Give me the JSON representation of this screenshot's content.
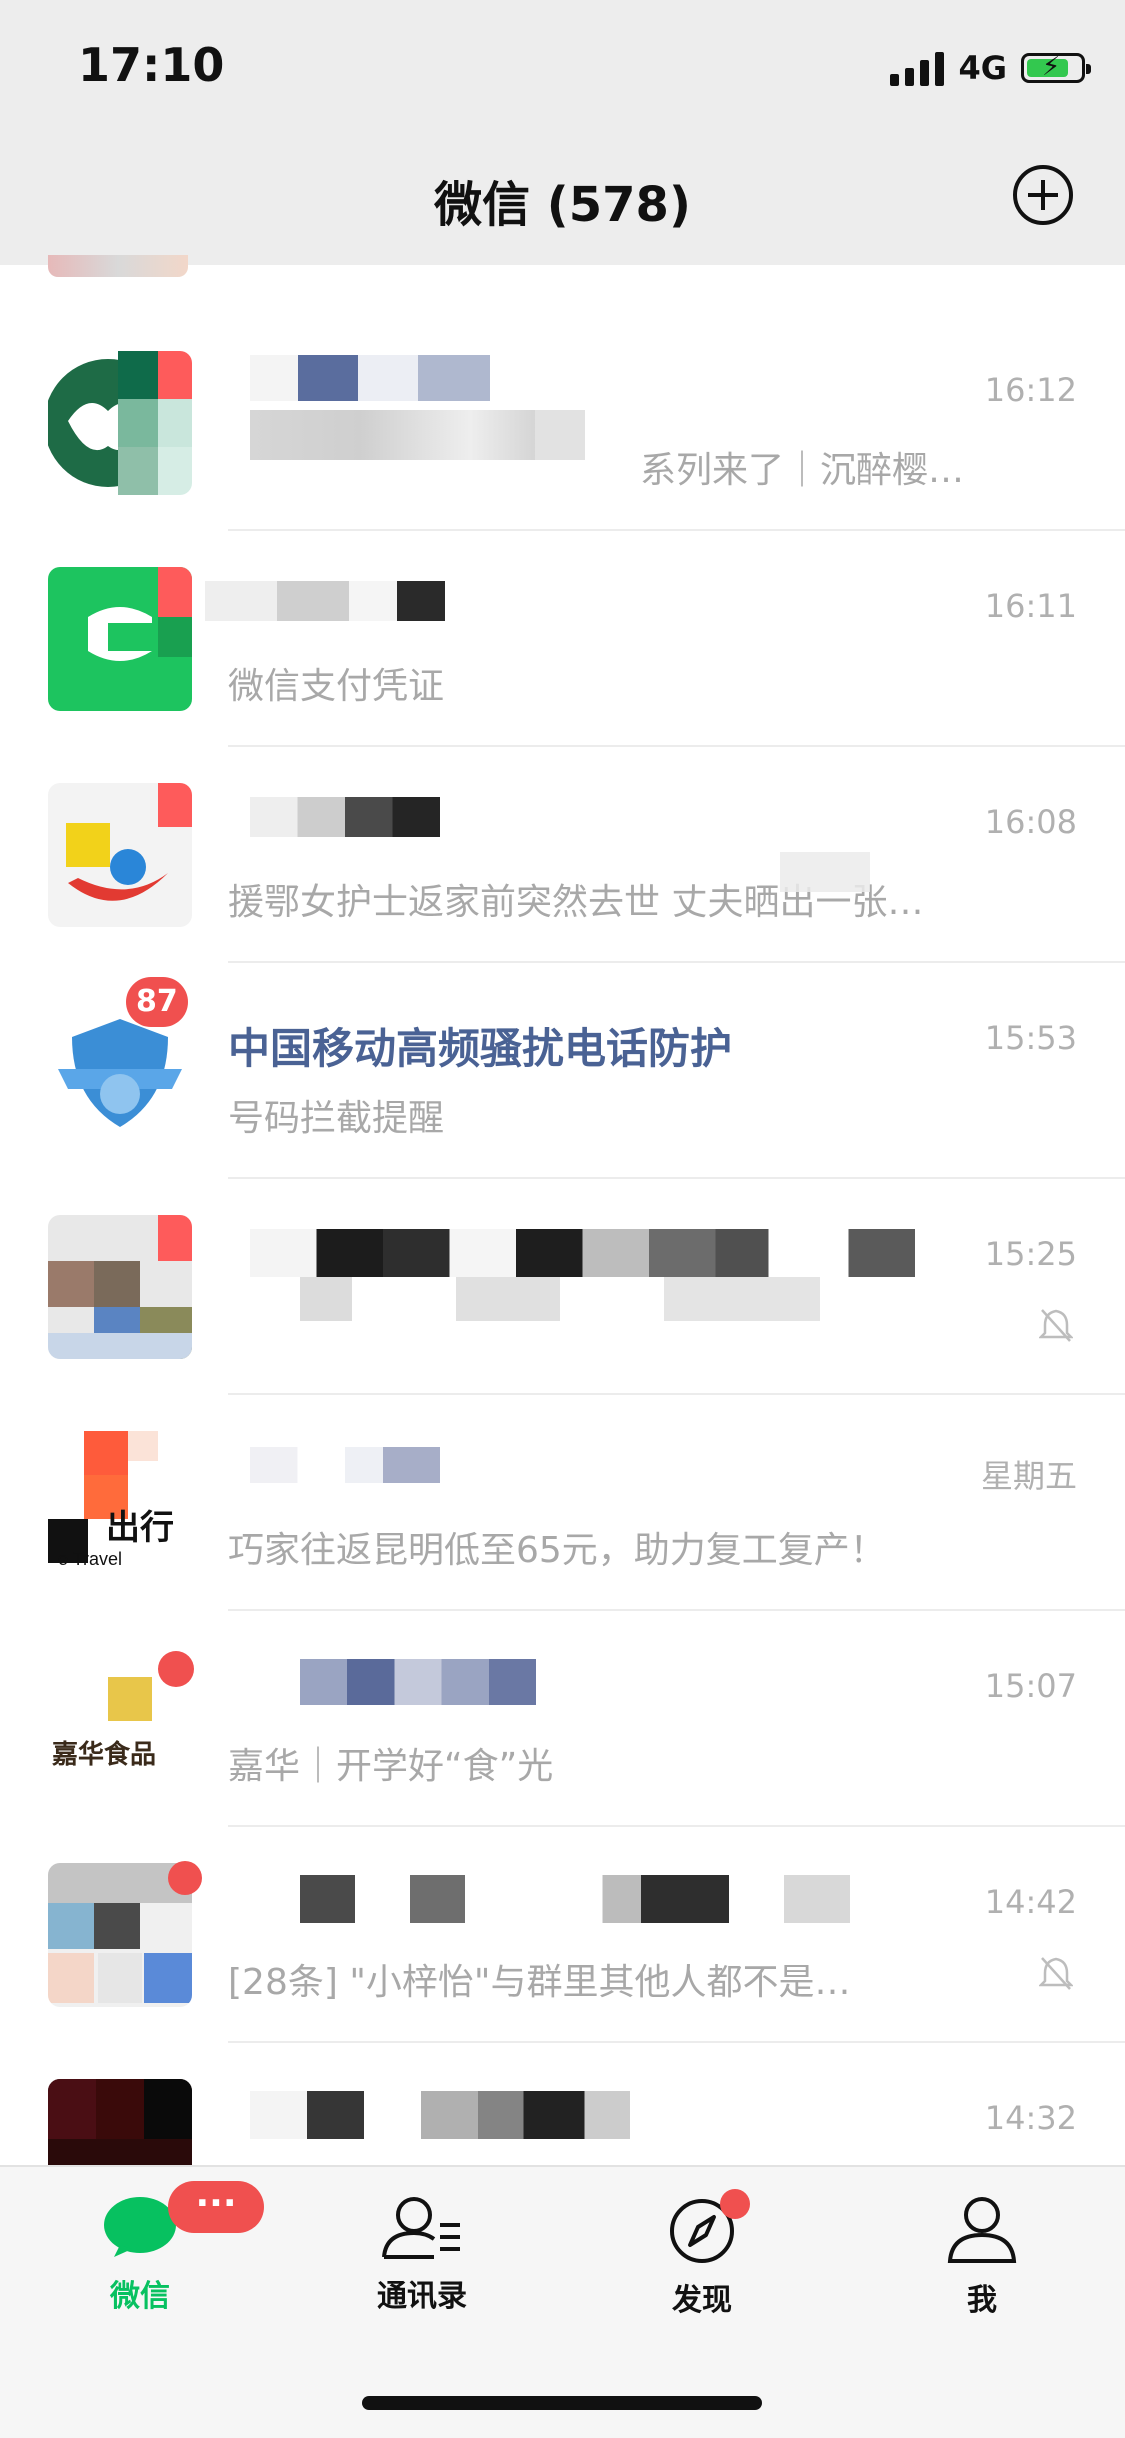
{
  "status_bar": {
    "time": "17:10",
    "network": "4G"
  },
  "header": {
    "title": "微信 (578)",
    "add_button_icon": "plus-circle-icon"
  },
  "chats": [
    {
      "name": "",
      "time": "16:12",
      "preview": "系列来了｜沉醉樱…",
      "avatar_icon": "starbucks-logo"
    },
    {
      "name": "",
      "time": "16:11",
      "preview": "微信支付凭证",
      "avatar_icon": "wechat-pay-logo"
    },
    {
      "name": "",
      "time": "16:08",
      "preview": "援鄂女护士返家前突然去世 丈夫晒出一张…",
      "avatar_icon": "news-logo"
    },
    {
      "name": "中国移动高频骚扰电话防护",
      "time": "15:53",
      "preview": "号码拦截提醒",
      "badge": "87",
      "avatar_icon": "shield-logo"
    },
    {
      "name": "",
      "time": "15:25",
      "preview": "",
      "muted": true,
      "avatar_icon": "group-avatar"
    },
    {
      "name": "",
      "time": "星期五",
      "preview": "巧家往返昆明低至65元，助力复工复产！",
      "avatar_icon": "travel-logo",
      "avatar_text": "出行"
    },
    {
      "name": "",
      "time": "15:07",
      "preview": "嘉华｜开学好“食”光",
      "avatar_icon": "food-logo",
      "avatar_text": "嘉华食品"
    },
    {
      "name": "",
      "time": "14:42",
      "preview": "[28条] \"小梓怡\"与群里其他人都不是…",
      "muted": true,
      "avatar_icon": "group-avatar"
    },
    {
      "name": "",
      "time": "14:32",
      "preview": "",
      "avatar_icon": "photo-avatar"
    }
  ],
  "tabbar": {
    "tabs": [
      {
        "label": "微信",
        "icon": "chat-bubble-icon",
        "active": true,
        "badge": "···"
      },
      {
        "label": "通讯录",
        "icon": "contacts-icon"
      },
      {
        "label": "发现",
        "icon": "compass-icon",
        "dot": true
      },
      {
        "label": "我",
        "icon": "person-icon"
      }
    ]
  },
  "colors": {
    "accent": "#07c160",
    "badge": "#f0504f",
    "link_name": "#4a6294"
  }
}
